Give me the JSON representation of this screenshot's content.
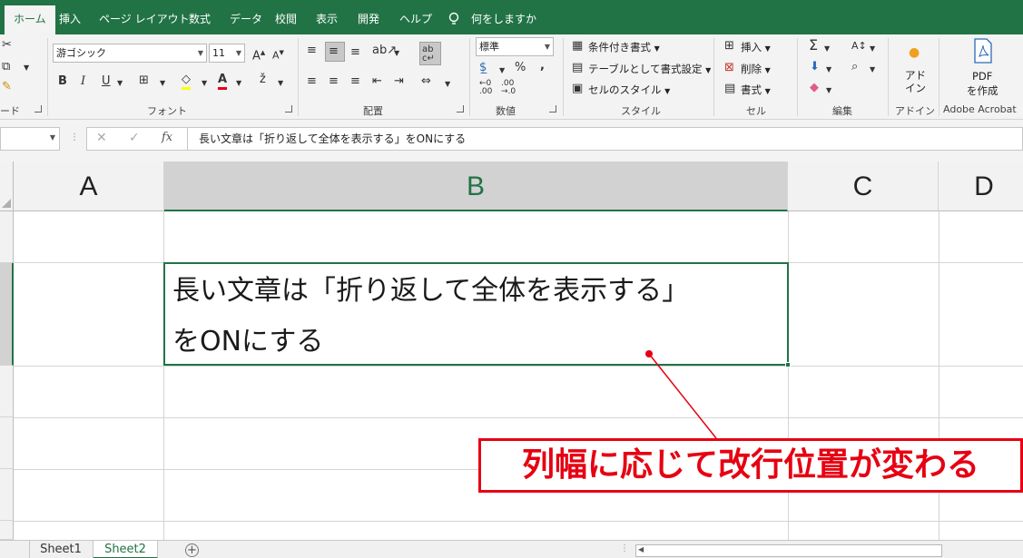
{
  "ribbon_tabs": [
    {
      "label": "ホーム",
      "active": true
    },
    {
      "label": "挿入"
    },
    {
      "label": "ページ レイアウト"
    },
    {
      "label": "数式"
    },
    {
      "label": "データ"
    },
    {
      "label": "校閲"
    },
    {
      "label": "表示"
    },
    {
      "label": "開発"
    },
    {
      "label": "ヘルプ"
    }
  ],
  "tell_me": "何をしますか",
  "clipboard": {
    "label_partial": "ード"
  },
  "font": {
    "name": "游ゴシック",
    "size": "11",
    "group_label": "フォント",
    "bold": "B",
    "italic": "I",
    "underline": "U"
  },
  "alignment": {
    "group_label": "配置"
  },
  "number": {
    "format": "標準",
    "percent": "%",
    "comma": ",",
    "inc_decimal": ".00→.0",
    "group_label": "数値"
  },
  "styles": {
    "conditional": "条件付き書式",
    "table": "テーブルとして書式設定",
    "cell_styles": "セルのスタイル",
    "group_label": "スタイル"
  },
  "cells": {
    "insert": "挿入",
    "delete": "削除",
    "format": "書式",
    "group_label": "セル"
  },
  "editing": {
    "group_label": "編集"
  },
  "addins": {
    "button_label": "アド\nイン",
    "group_label": "アドイン"
  },
  "acrobat": {
    "button_label_1": "PDF",
    "button_label_2": "を作成",
    "group_label": "Adobe Acrobat"
  },
  "formula_bar": {
    "cancel": "✕",
    "enter": "✓",
    "fx": "fx",
    "content": "長い文章は「折り返して全体を表示する」をONにする"
  },
  "columns": [
    "A",
    "B",
    "C",
    "D"
  ],
  "active_cell": {
    "line1": "長い文章は「折り返して全体を表示する」",
    "line2": "をONにする"
  },
  "callout": "列幅に応じて改行位置が変わる",
  "sheets": [
    {
      "label": "Sheet1"
    },
    {
      "label": "Sheet2",
      "active": true
    }
  ],
  "add_sheet": "+",
  "colors": {
    "accent": "#217346",
    "callout": "#e60012"
  }
}
